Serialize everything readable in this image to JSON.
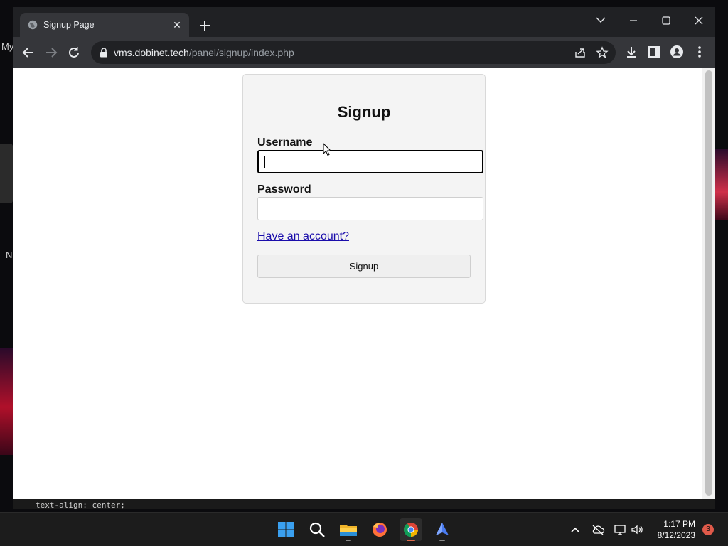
{
  "desktop": {
    "fragments": [
      "My",
      "N"
    ]
  },
  "code_fragment": "text-align: center;",
  "browser": {
    "tab": {
      "title": "Signup Page"
    },
    "address": {
      "host": "vms.dobinet.tech",
      "path": "/panel/signup/index.php"
    }
  },
  "page": {
    "heading": "Signup",
    "username_label": "Username",
    "username_value": "",
    "password_label": "Password",
    "password_value": "",
    "account_link": "Have an account?",
    "submit_label": "Signup"
  },
  "taskbar": {
    "apps": [
      "start-icon",
      "search-icon",
      "file-explorer-icon",
      "firefox-icon",
      "chrome-icon",
      "app-icon"
    ],
    "time": "1:17 PM",
    "date": "8/12/2023",
    "notifications": "3"
  },
  "colors": {
    "tab_bg": "#35363a",
    "titlebar_bg": "#202124",
    "link": "#1a0dab",
    "accent_indicator": "#e06a4a"
  }
}
